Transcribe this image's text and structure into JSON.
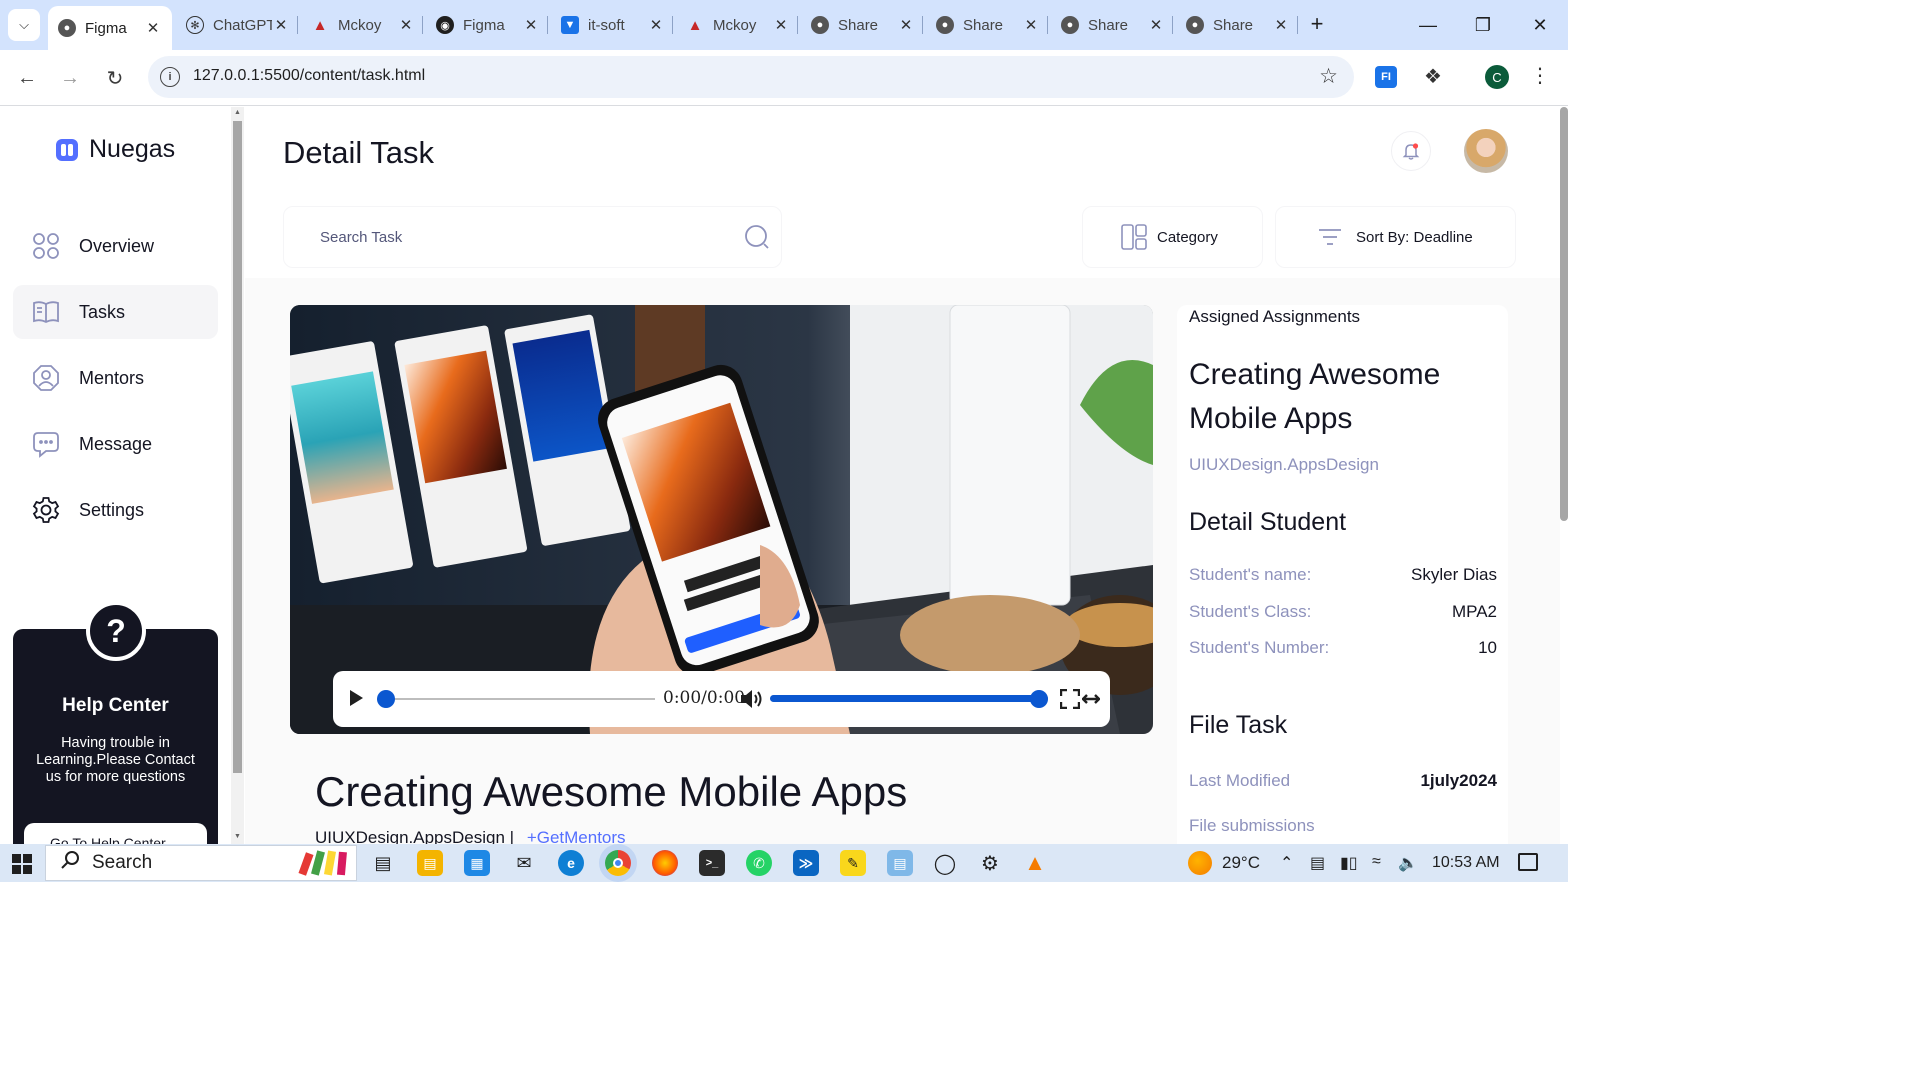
{
  "browser": {
    "tabs": [
      {
        "title": "Figma",
        "favicon": "globe-icon",
        "active": true
      },
      {
        "title": "ChatGPT",
        "favicon": "openai-icon"
      },
      {
        "title": "Mckoy",
        "favicon": "triangle-icon"
      },
      {
        "title": "Figma",
        "favicon": "github-icon"
      },
      {
        "title": "it-soft",
        "favicon": "shield-icon"
      },
      {
        "title": "Mckoy",
        "favicon": "triangle-icon"
      },
      {
        "title": "Share",
        "favicon": "globe-icon"
      },
      {
        "title": "Share",
        "favicon": "globe-icon"
      },
      {
        "title": "Share",
        "favicon": "globe-icon"
      },
      {
        "title": "Share",
        "favicon": "globe-icon"
      }
    ],
    "url": "127.0.0.1:5500/content/task.html",
    "profile_initial": "C",
    "extension_label": "FI"
  },
  "sidebar": {
    "brand": "Nuegas",
    "items": [
      {
        "label": "Overview",
        "icon": "category-icon"
      },
      {
        "label": "Tasks",
        "icon": "book-icon",
        "active": true
      },
      {
        "label": "Mentors",
        "icon": "user-octagon-icon"
      },
      {
        "label": "Message",
        "icon": "message-icon"
      },
      {
        "label": "Settings",
        "icon": "gear-icon"
      }
    ],
    "help": {
      "icon_glyph": "?",
      "title": "Help Center",
      "text": "Having trouble in Learning.Please Contact us for more questions",
      "button": "Go To Help Center"
    }
  },
  "header": {
    "title": "Detail Task",
    "search_placeholder": "Search Task",
    "category_label": "Category",
    "sort_label": "Sort By: Deadline"
  },
  "video": {
    "time": "0:00/0:00",
    "progress": 0,
    "volume": 1.0
  },
  "task": {
    "title": "Creating Awesome Mobile Apps",
    "tags": "UIUXDesign.AppsDesign",
    "separator": "|",
    "mentors_link": "+GetMentors"
  },
  "assigned": {
    "label": "Assigned Assignments",
    "title": "Creating Awesome Mobile Apps",
    "tags": "UIUXDesign.AppsDesign",
    "detail_heading": "Detail Student",
    "student_name_label": "Student's name:",
    "student_name": "Skyler Dias",
    "student_class_label": "Student's Class:",
    "student_class": "MPA2",
    "student_number_label": "Student's Number:",
    "student_number": "10",
    "file_heading": "File Task",
    "last_modified_label": "Last Modified",
    "last_modified": "1july2024",
    "file_submissions_label": "File submissions"
  },
  "taskbar": {
    "search_label": "Search",
    "weather": "29°C",
    "time": "10:53 AM"
  },
  "colors": {
    "accent": "#546fff",
    "muted": "#8e92bc",
    "dark": "#141522",
    "chrome_tabs": "#d3e3fd"
  }
}
